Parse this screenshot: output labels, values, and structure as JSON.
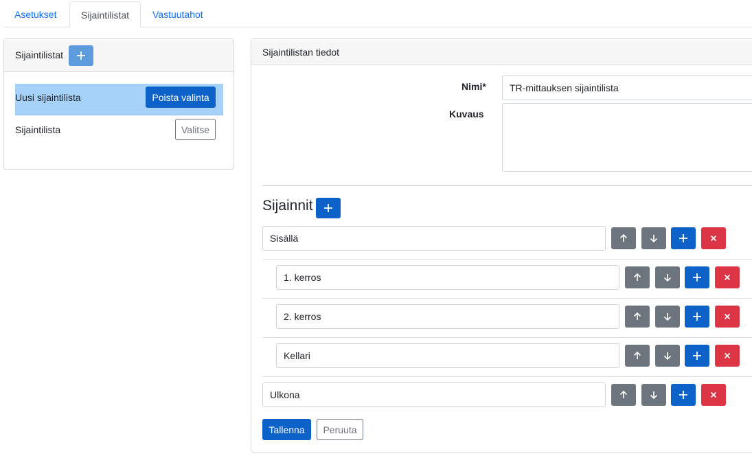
{
  "tabs": [
    {
      "label": "Asetukset"
    },
    {
      "label": "Sijaintilistat"
    },
    {
      "label": "Vastuutahot"
    }
  ],
  "left_panel": {
    "title": "Sijaintilistat",
    "items": [
      {
        "name": "Uusi sijaintilista",
        "action": "Poista valinta",
        "selected": true
      },
      {
        "name": "Sijaintilista",
        "action": "Valitse",
        "selected": false
      }
    ]
  },
  "right_panel": {
    "title": "Sijaintilistan tiedot",
    "name_label": "Nimi*",
    "name_value": "TR-mittauksen sijaintilista",
    "description_label": "Kuvaus",
    "description_value": "",
    "locations_title": "Sijainnit",
    "locations": [
      {
        "name": "Sisällä",
        "level": 0
      },
      {
        "name": "1. kerros",
        "level": 1
      },
      {
        "name": "2. kerros",
        "level": 1
      },
      {
        "name": "Kellari",
        "level": 1
      },
      {
        "name": "Ulkona",
        "level": 0
      }
    ],
    "save_label": "Tallenna",
    "cancel_label": "Peruuta"
  },
  "colors": {
    "primary": "#0d62c9",
    "secondary": "#6c757d",
    "danger": "#dc3545",
    "selected_row": "#a6d2fa"
  }
}
